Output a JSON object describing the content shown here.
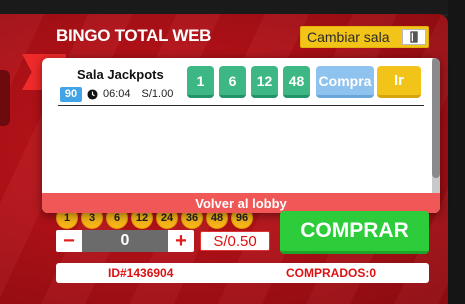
{
  "header": {
    "title": "BINGO TOTAL WEB",
    "change_room_label": "Cambiar sala"
  },
  "modal": {
    "room_name": "Sala Jackpots",
    "room_number": "90",
    "time": "06:04",
    "price": "S/1.00",
    "quantity_options": [
      "1",
      "6",
      "12",
      "48"
    ],
    "buy_label": "Compra",
    "go_label": "Ir",
    "back_label": "Volver al lobby"
  },
  "controls": {
    "balls": [
      "1",
      "3",
      "6",
      "12",
      "24",
      "36",
      "48",
      "96"
    ],
    "stepper_value": "0",
    "minus_label": "−",
    "plus_label": "+",
    "price": "S/0.50",
    "buy_label": "COMPRAR"
  },
  "status": {
    "id": "ID#1436904",
    "purchased": "COMPRADOS:0"
  },
  "colors": {
    "panel_red": "#b01117",
    "accent_yellow": "#f2c318",
    "qty_green": "#3db884",
    "buy_blue": "#8fc3ef",
    "main_buy_green": "#2ccc3a",
    "back_red": "#f05757",
    "room_blue": "#42a3e6"
  },
  "icons": [
    "door-exit-icon",
    "clock-icon",
    "ribbon-icon"
  ]
}
